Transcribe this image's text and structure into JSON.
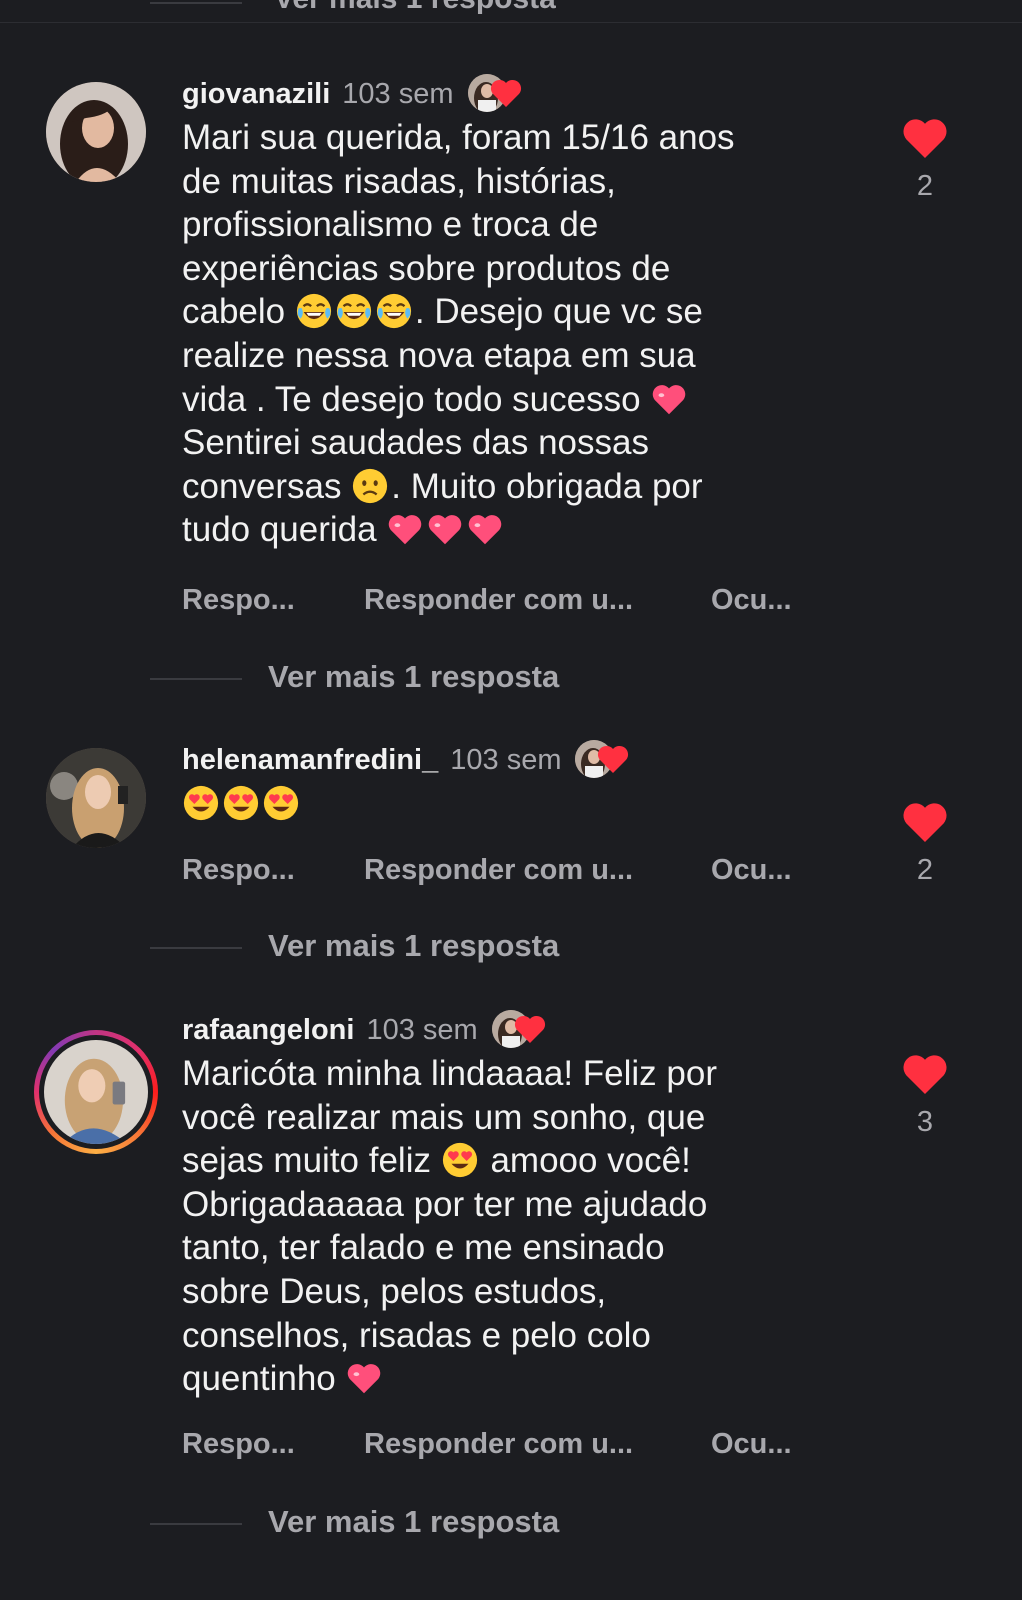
{
  "partial_top": {
    "more_replies": "Ver mais 1 resposta"
  },
  "comments": [
    {
      "username": "giovanazili",
      "time": "103 sem",
      "lines": [
        "Mari sua querida, foram 15/16 anos",
        "de muitas risadas, histórias,",
        "profissionalismo e troca de",
        "experiências sobre produtos de",
        [
          "cabelo ",
          {
            "emoji": "joy"
          },
          {
            "emoji": "joy"
          },
          {
            "emoji": "joy"
          },
          ". Desejo que vc se"
        ],
        "realize nessa nova etapa em sua",
        [
          "vida . Te desejo todo sucesso ",
          {
            "emoji": "pink-heart"
          }
        ],
        "Sentirei saudades das nossas",
        [
          "conversas ",
          {
            "emoji": "frown"
          },
          ". Muito obrigada por"
        ],
        [
          "tudo querida ",
          {
            "emoji": "pink-heart"
          },
          {
            "emoji": "pink-heart"
          },
          {
            "emoji": "pink-heart"
          }
        ]
      ],
      "actions": {
        "reply": "Respo...",
        "react": "Responder com u...",
        "hide": "Ocu..."
      },
      "more_replies": "Ver mais 1 resposta",
      "like_count": "2",
      "story_ring": false
    },
    {
      "username": "helenamanfredini_",
      "time": "103 sem",
      "lines": [
        [
          {
            "emoji": "heart-eyes"
          },
          {
            "emoji": "heart-eyes"
          },
          {
            "emoji": "heart-eyes"
          }
        ]
      ],
      "actions": {
        "reply": "Respo...",
        "react": "Responder com u...",
        "hide": "Ocu..."
      },
      "more_replies": "Ver mais 1 resposta",
      "like_count": "2",
      "story_ring": false
    },
    {
      "username": "rafaangeloni",
      "time": "103 sem",
      "lines": [
        "Maricóta minha lindaaaa! Feliz por",
        "você realizar mais um sonho, que",
        [
          "sejas muito feliz ",
          {
            "emoji": "heart-eyes"
          },
          " amooo você!"
        ],
        "Obrigadaaaaa por ter me ajudado",
        "tanto, ter falado e me ensinado",
        "sobre Deus, pelos estudos,",
        "conselhos, risadas e pelo colo",
        [
          "quentinho ",
          {
            "emoji": "pink-heart"
          }
        ]
      ],
      "actions": {
        "reply": "Respo...",
        "react": "Responder com u...",
        "hide": "Ocu..."
      },
      "more_replies": "Ver mais 1 resposta",
      "like_count": "3",
      "story_ring": true
    }
  ],
  "colors": {
    "background": "#1c1d21",
    "text": "#f2f2f2",
    "muted": "#a8a8ad",
    "like_red": "#ff3040"
  }
}
